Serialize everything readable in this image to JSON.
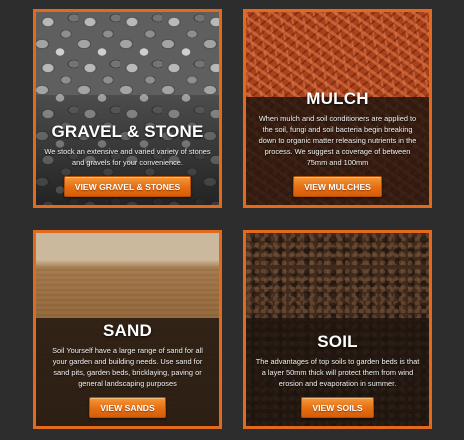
{
  "cards": [
    {
      "title": "GRAVEL & STONE",
      "description": "We stock an extensive and varied variety of stones and gravels for your convenience.",
      "button": "VIEW GRAVEL & STONES",
      "image": "gravel-photo"
    },
    {
      "title": "MULCH",
      "description": "When mulch and soil conditioners are applied to the soil, fungi and soil bacteria begin breaking down to organic matter releasing nutrients in the process. We suggest a coverage of between 75mm and 100mm",
      "button": "VIEW MULCHES",
      "image": "mulch-photo"
    },
    {
      "title": "SAND",
      "description": "Soil Yourself have a large range of sand for all your garden and building needs. Use sand for sand pits, garden beds, bricklaying, paving or general landscaping purposes",
      "button": "VIEW SANDS",
      "image": "sand-photo"
    },
    {
      "title": "SOIL",
      "description": "The advantages of top soils to garden beds is that a layer 50mm thick will protect them from wind erosion and evaporation in summer.",
      "button": "VIEW SOILS",
      "image": "soil-photo"
    }
  ],
  "colors": {
    "background": "#2d2d2d",
    "accent": "#e36a1c",
    "button": "#e66d13"
  }
}
